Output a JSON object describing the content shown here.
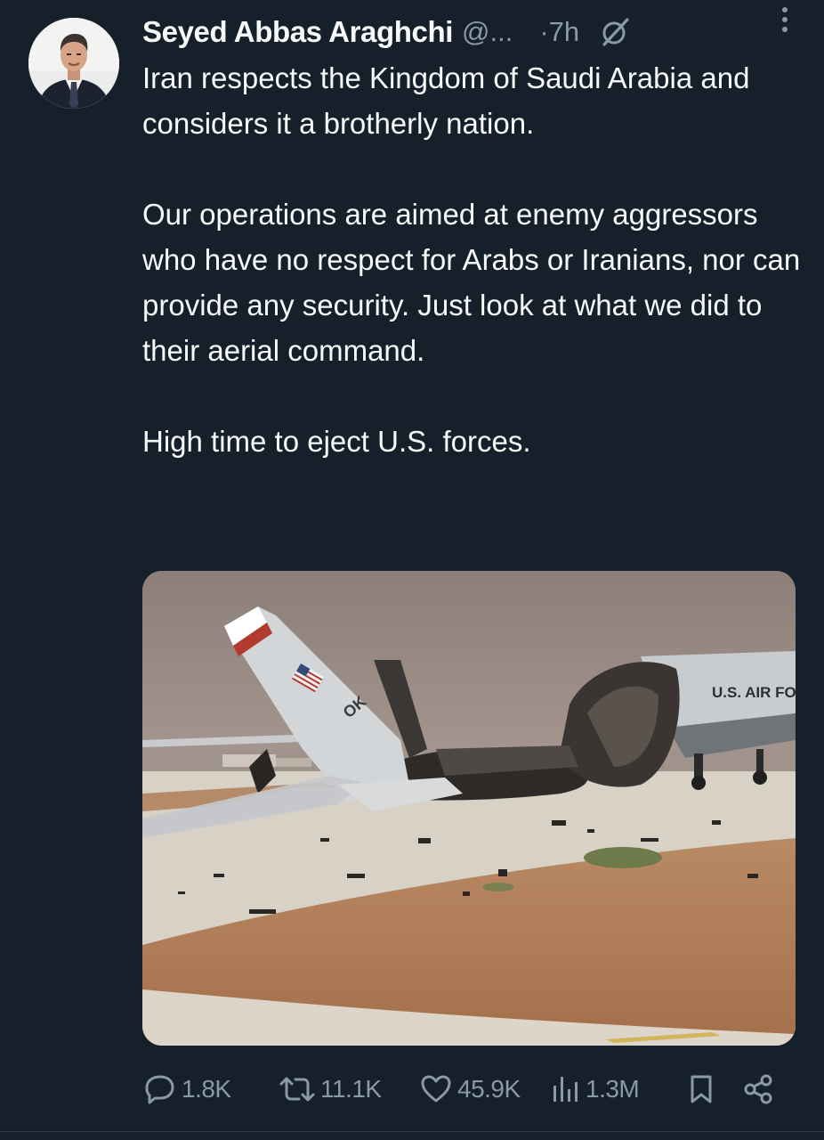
{
  "author": {
    "name": "Seyed Abbas Araghchi",
    "handle": "@...",
    "time": "·7h",
    "avatar_icon": "profile-photo"
  },
  "tweet": {
    "paragraphs": [
      "Iran respects the Kingdom of Saudi Arabia and considers it a brotherly nation.",
      "Our operations are aimed at enemy aggressors who have no respect for Arabs or Iranians, nor can provide any security. Just look at what we did to their aerial command.",
      "High time to eject U.S. forces."
    ]
  },
  "media": {
    "fuselage_text": "U.S. AIR FORC",
    "tail_text": "OK"
  },
  "actions": {
    "replies": "1.8K",
    "reposts": "11.1K",
    "likes": "45.9K",
    "views": "1.3M"
  },
  "colors": {
    "background": "#15202b",
    "text": "#f7f9f9",
    "secondary": "#8b98a5"
  }
}
